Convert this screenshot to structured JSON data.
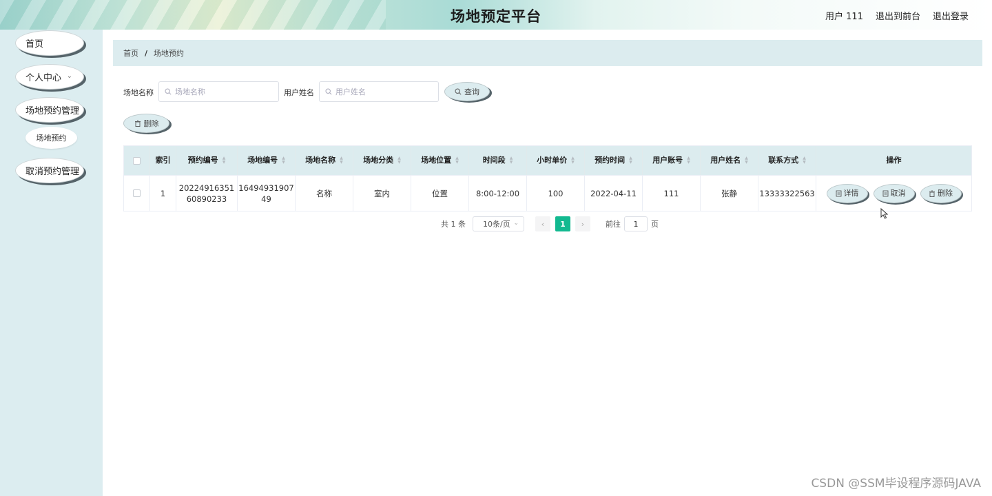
{
  "header": {
    "title": "场地预定平台",
    "user": "用户 111",
    "to_front": "退出到前台",
    "logout": "退出登录"
  },
  "sidebar": {
    "home": "首页",
    "personal_center": "个人中心",
    "booking_mgmt": "场地预约管理",
    "booking_sub": "场地预约",
    "cancel_mgmt": "取消预约管理"
  },
  "breadcrumb": {
    "home": "首页",
    "separator": "/",
    "current": "场地预约"
  },
  "search": {
    "venue_name_label": "场地名称",
    "venue_name_placeholder": "场地名称",
    "user_name_label": "用户姓名",
    "user_name_placeholder": "用户姓名",
    "query_label": "查询",
    "delete_label": "删除"
  },
  "table": {
    "columns": [
      "索引",
      "预约编号",
      "场地编号",
      "场地名称",
      "场地分类",
      "场地位置",
      "时间段",
      "小时单价",
      "预约时间",
      "用户账号",
      "用户姓名",
      "联系方式",
      "操作"
    ],
    "rows": [
      {
        "index": "1",
        "booking_no_1": "20224916351",
        "booking_no_2": "60890233",
        "venue_no_1": "16494931907",
        "venue_no_2": "49",
        "venue_name": "名称",
        "category": "室内",
        "location": "位置",
        "time_slot": "8:00-12:00",
        "hourly_price": "100",
        "booking_time": "2022-04-11",
        "account": "111",
        "user_name": "张静",
        "phone": "13333322563"
      }
    ],
    "actions": {
      "detail": "详情",
      "cancel": "取消",
      "delete": "删除"
    }
  },
  "pagination": {
    "total": "共 1 条",
    "page_size": "10条/页",
    "current_page": "1",
    "goto_label": "前往",
    "goto_value": "1",
    "page_suffix": "页"
  },
  "watermark": "CSDN @SSM毕设程序源码JAVA",
  "colors": {
    "sidebar_bg": "#dcedf0",
    "accent": "#12b990",
    "header_row": "#dcecef"
  }
}
